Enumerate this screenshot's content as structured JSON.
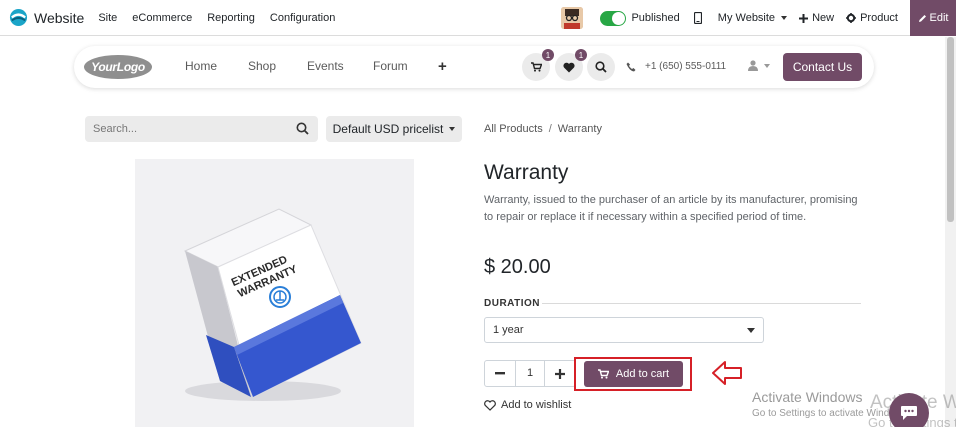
{
  "topbar": {
    "app_name": "Website",
    "menu": [
      "Site",
      "eCommerce",
      "Reporting",
      "Configuration"
    ],
    "published_label": "Published",
    "website_label": "My Website",
    "new_label": "New",
    "product_label": "Product",
    "edit_label": "Edit"
  },
  "header": {
    "logo_text": "YourLogo",
    "nav": [
      "Home",
      "Shop",
      "Events",
      "Forum"
    ],
    "cart_count": "1",
    "wishlist_count": "1",
    "phone": "+1 (650) 555-0111",
    "contact_label": "Contact Us"
  },
  "search": {
    "placeholder": "Search..."
  },
  "pricelist_label": "Default USD pricelist",
  "breadcrumb": {
    "parent": "All Products",
    "separator": "/",
    "current": "Warranty"
  },
  "product": {
    "name": "Warranty",
    "description": "Warranty, issued to the purchaser of an article by its manufacturer, promising to repair or replace it if necessary within a specified period of time.",
    "price": "$ 20.00",
    "box_text": [
      "EXTENDED",
      "WARRANTY"
    ],
    "attribute_label": "DURATION",
    "duration_value": "1 year",
    "quantity": "1",
    "add_to_cart_label": "Add to cart",
    "wishlist_label": "Add to wishlist"
  },
  "watermark": {
    "title": "Activate Windows",
    "subtitle": "Go to Settings to activate Windows."
  },
  "colors": {
    "primary": "#714b67",
    "highlight": "#d62027",
    "published": "#28a745"
  }
}
